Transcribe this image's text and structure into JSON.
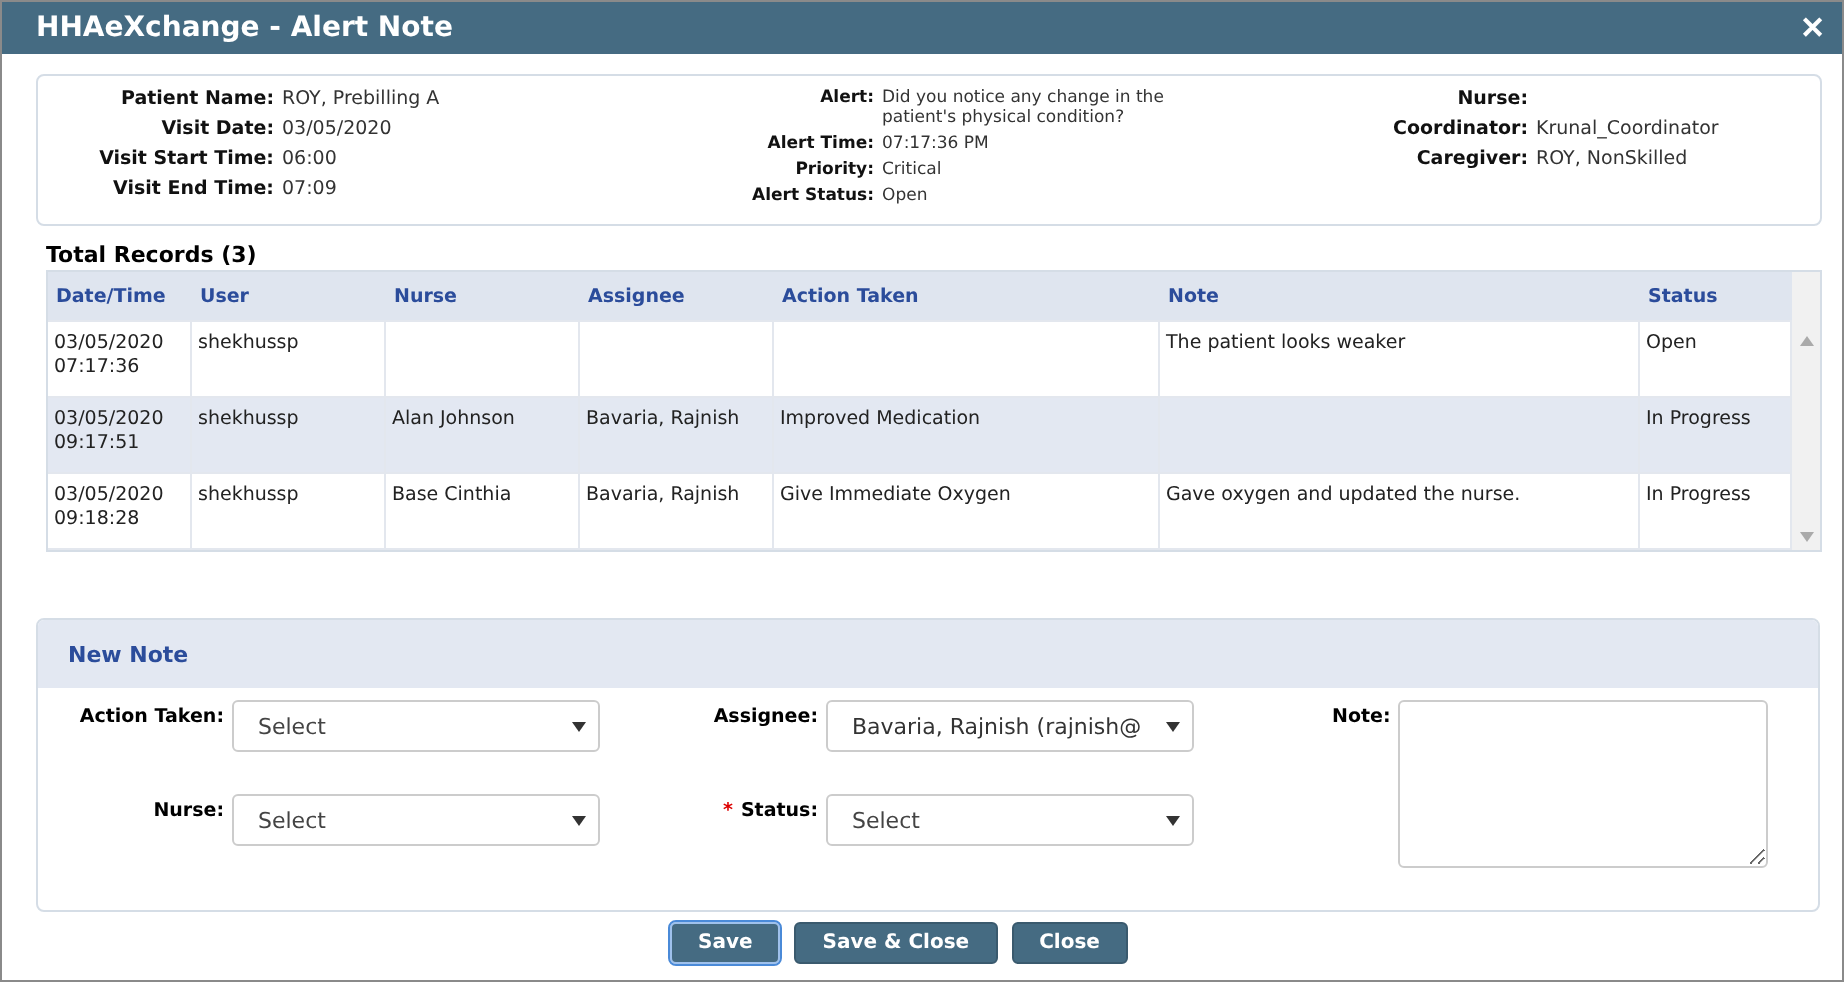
{
  "window": {
    "title": "HHAeXchange - Alert Note",
    "close": "✕"
  },
  "info": {
    "columns": [
      [
        {
          "label": "Patient Name:",
          "value": "ROY, Prebilling A"
        },
        {
          "label": "Visit Date:",
          "value": "03/05/2020"
        },
        {
          "label": "Visit Start Time:",
          "value": "06:00"
        },
        {
          "label": "Visit End Time:",
          "value": "07:09"
        }
      ],
      [
        {
          "label": "Alert:",
          "value": "Did you notice any change in the patient's physical condition?"
        },
        {
          "label": "Alert Time:",
          "value": "07:17:36  PM"
        },
        {
          "label": "Priority:",
          "value": "Critical"
        },
        {
          "label": "Alert Status:",
          "value": "Open"
        }
      ],
      [
        {
          "label": "Nurse:"
        },
        {
          "label": "Coordinator:",
          "value": "Krunal_Coordinator"
        },
        {
          "label": "Caregiver:",
          "value": "ROY, NonSkilled"
        }
      ]
    ]
  },
  "table": {
    "heading": "Total Records (3)",
    "columns": [
      "Date/Time",
      "User",
      "Nurse",
      "Assignee",
      "Action Taken",
      "Note",
      "Status"
    ],
    "rows": [
      [
        "03/05/2020 07:17:36",
        "shekhussp",
        "",
        "",
        "",
        "The patient looks weaker",
        "Open"
      ],
      [
        "03/05/2020 09:17:51",
        "shekhussp",
        "Alan Johnson",
        "Bavaria, Rajnish",
        "Improved Medication",
        "",
        "In Progress"
      ],
      [
        "03/05/2020 09:18:28",
        "shekhussp",
        "Base Cinthia",
        "Bavaria, Rajnish",
        "Give Immediate Oxygen",
        "Gave oxygen and updated the nurse.",
        "In Progress"
      ]
    ]
  },
  "new_note": {
    "title": "New Note",
    "fields": [
      {
        "label": "Action Taken:",
        "placeholder": "Select"
      },
      {
        "label": "Assignee:",
        "value": "Bavaria, Rajnish (rajnish@"
      },
      {
        "label": "Nurse:",
        "placeholder": "Select"
      },
      {
        "label": "Status:",
        "placeholder": "Select",
        "required_mark": "*"
      }
    ],
    "note": {
      "label": "Note:"
    }
  },
  "buttons": [
    {
      "label": "Save",
      "focused": true
    },
    {
      "label": "Save & Close",
      "focused": false
    },
    {
      "label": "Close",
      "focused": false
    }
  ]
}
